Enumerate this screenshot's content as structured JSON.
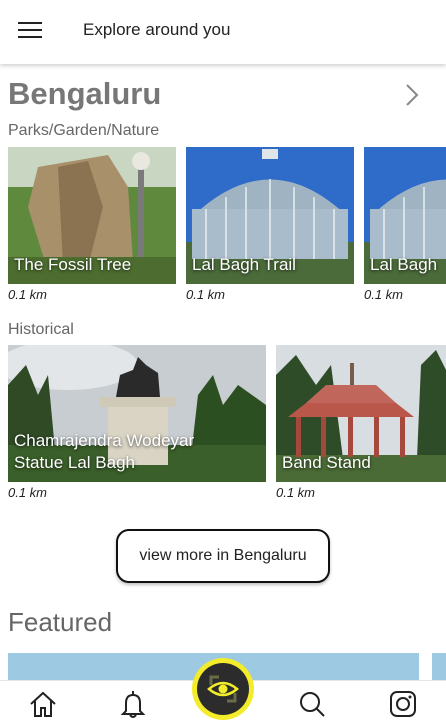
{
  "header": {
    "title": "Explore around you"
  },
  "city": {
    "name": "Bengaluru"
  },
  "sections": [
    {
      "label": "Parks/Garden/Nature",
      "cards": [
        {
          "name": "The Fossil Tree",
          "distance": "0.1 km"
        },
        {
          "name": "Lal Bagh Trail",
          "distance": "0.1 km"
        },
        {
          "name": "Lal Bagh",
          "distance": "0.1 km"
        }
      ]
    },
    {
      "label": "Historical",
      "cards": [
        {
          "name": "Chamrajendra Wodeyar Statue Lal Bagh",
          "distance": "0.1 km"
        },
        {
          "name": "Band Stand",
          "distance": "0.1 km"
        }
      ]
    }
  ],
  "view_more_label": "view more in Bengaluru",
  "featured": {
    "title": "Featured"
  },
  "nav": {
    "items": [
      "home-icon",
      "bell-icon",
      "eye-icon",
      "search-icon",
      "camera-icon"
    ],
    "accent": "#f2ec2a"
  }
}
